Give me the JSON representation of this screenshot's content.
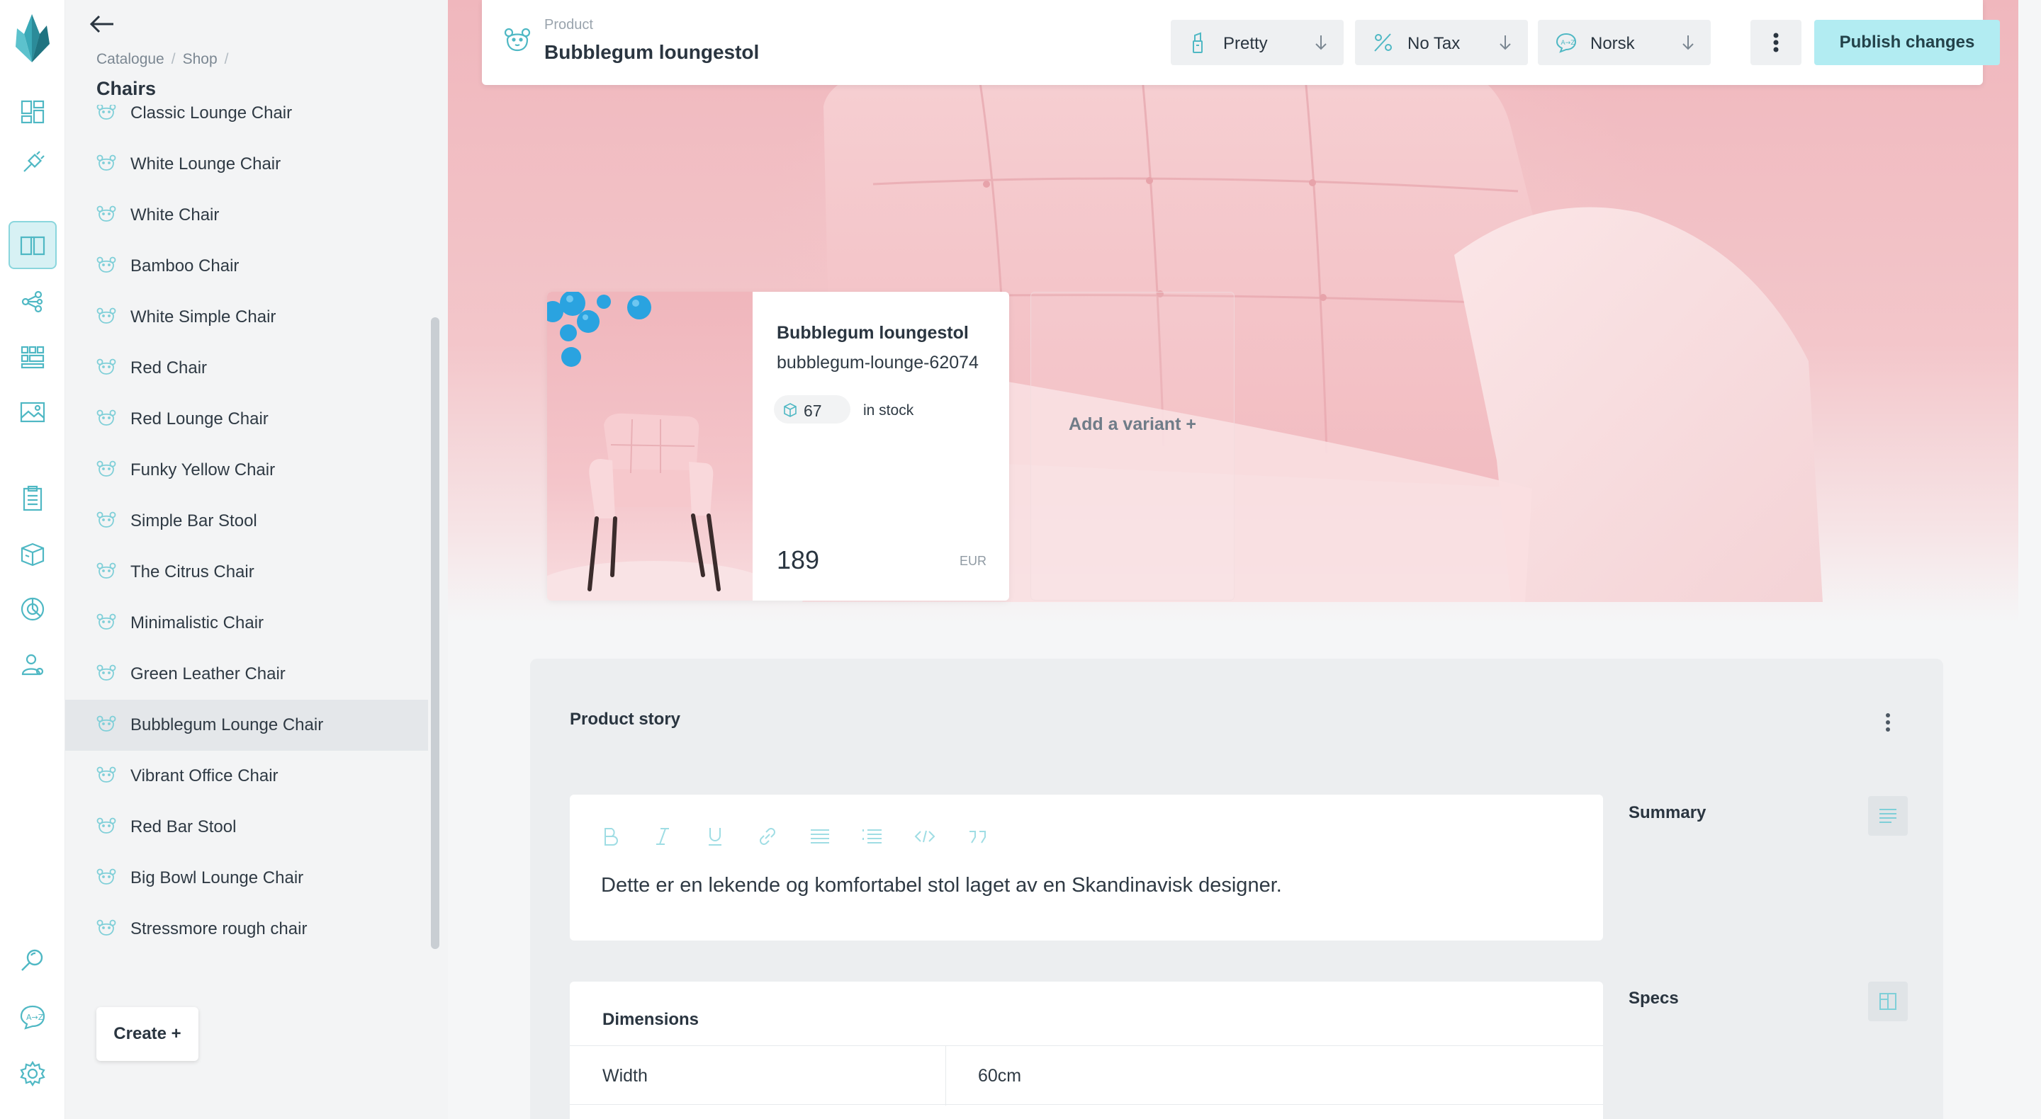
{
  "breadcrumb": [
    "Catalogue",
    "Shop"
  ],
  "panel_title": "Chairs",
  "items": [
    {
      "label": "Classic Lounge Chair"
    },
    {
      "label": "White Lounge Chair"
    },
    {
      "label": "White Chair"
    },
    {
      "label": "Bamboo Chair"
    },
    {
      "label": "White Simple Chair"
    },
    {
      "label": "Red Chair"
    },
    {
      "label": "Red Lounge Chair"
    },
    {
      "label": "Funky Yellow Chair"
    },
    {
      "label": "Simple Bar Stool"
    },
    {
      "label": "The Citrus Chair"
    },
    {
      "label": "Minimalistic Chair"
    },
    {
      "label": "Green Leather Chair"
    },
    {
      "label": "Bubblegum Lounge Chair",
      "selected": true
    },
    {
      "label": "Vibrant Office Chair"
    },
    {
      "label": "Red Bar Stool"
    },
    {
      "label": "Big Bowl Lounge Chair"
    },
    {
      "label": "Stressmore rough chair"
    }
  ],
  "create_label": "Create +",
  "topbar": {
    "kicker": "Product",
    "title": "Bubblegum loungestol",
    "dropdowns": [
      {
        "label": "Pretty",
        "icon": "brush-icon"
      },
      {
        "label": "No Tax",
        "icon": "percent-icon"
      },
      {
        "label": "Norsk",
        "icon": "language-icon"
      }
    ],
    "publish_label": "Publish changes"
  },
  "variant": {
    "name": "Bubblegum loungestol",
    "sku": "bubblegum-lounge-62074",
    "stock": "67",
    "stock_label": "in stock",
    "price": "189",
    "currency": "EUR"
  },
  "add_variant_label": "Add a variant +",
  "story": {
    "title": "Product story",
    "summary_text": "Dette er en lekende og komfortabel stol laget av en Skandinavisk designer.",
    "summary_label": "Summary",
    "specs_label": "Specs",
    "dimensions_title": "Dimensions",
    "rows": [
      {
        "key": "Width",
        "value": "60cm"
      }
    ]
  },
  "colors": {
    "accent": "#b2ecf2",
    "accent_dark": "#4fb8c4",
    "selected_row": "#e4e7ea"
  }
}
